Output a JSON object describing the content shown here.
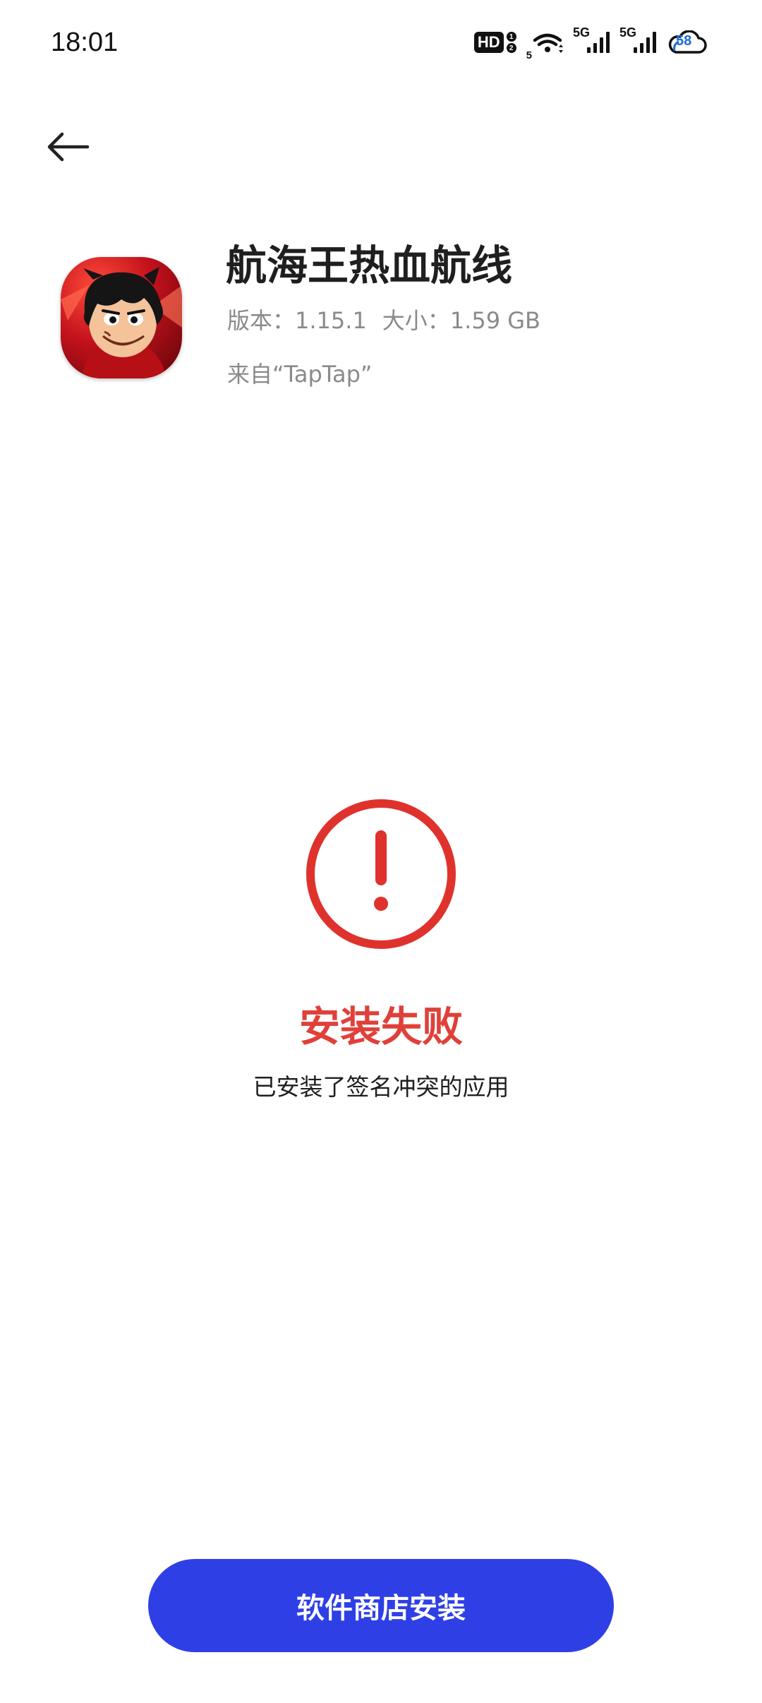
{
  "status_bar": {
    "time": "18:01",
    "hd_label": "HD",
    "sim_numbers": [
      "1",
      "2"
    ],
    "wifi_label": "5",
    "network_1": "5G",
    "network_2": "5G",
    "cloud_label": "58"
  },
  "app": {
    "title": "航海王热血航线",
    "version_label": "版本：",
    "version": "1.15.1",
    "size_label": "大小：",
    "size": "1.59 GB",
    "source": "来自“TapTap”"
  },
  "result": {
    "title": "安装失败",
    "reason": "已安装了签名冲突的应用",
    "status_color": "#e0403a"
  },
  "actions": {
    "store_install_label": "软件商店安装",
    "button_color": "#2f3fe6"
  }
}
